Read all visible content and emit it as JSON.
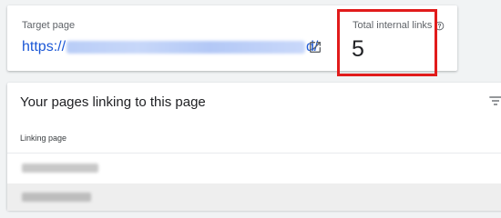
{
  "target_card": {
    "label": "Target page",
    "url_prefix": "https://",
    "url_suffix": "d/",
    "open_icon": "open-in-new-icon"
  },
  "summary": {
    "label": "Total internal links",
    "help_icon": "help-circle-icon",
    "count": "5"
  },
  "links_section": {
    "title": "Your pages linking to this page",
    "filter_icon": "filter-icon",
    "column_header": "Linking page"
  },
  "colors": {
    "link": "#1a57d6",
    "highlight": "#e11b1b"
  }
}
